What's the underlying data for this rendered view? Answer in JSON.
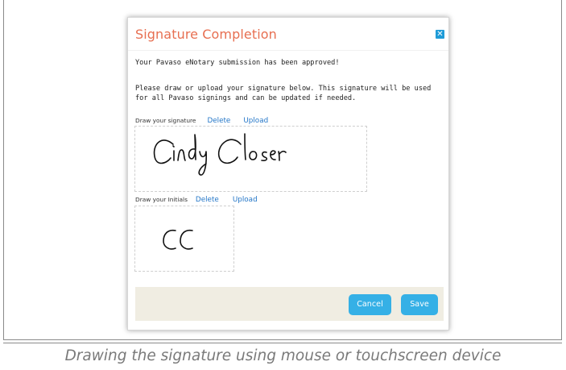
{
  "dialog": {
    "title": "Signature Completion",
    "close_icon": "close-icon",
    "close_glyph": "✕",
    "approved_message": "Your Pavaso eNotary submission has been approved!",
    "instructions": "Please draw or upload your signature below. This signature will be used for all Pavaso signings and can be updated if needed."
  },
  "signature": {
    "label": "Draw your signature",
    "delete_label": "Delete",
    "upload_label": "Upload",
    "drawn_text": "Cindy Closer"
  },
  "initials": {
    "label": "Draw your Initials",
    "delete_label": "Delete",
    "upload_label": "Upload",
    "drawn_text": "CC"
  },
  "footer": {
    "cancel_label": "Cancel",
    "save_label": "Save"
  },
  "caption": "Drawing the signature using mouse or touchscreen device",
  "colors": {
    "title": "#e76f51",
    "accent_button": "#35b0e6",
    "close_button": "#1f9bd7",
    "link": "#2577c8",
    "footer_background": "#f0ede2",
    "ink": "#111111"
  }
}
